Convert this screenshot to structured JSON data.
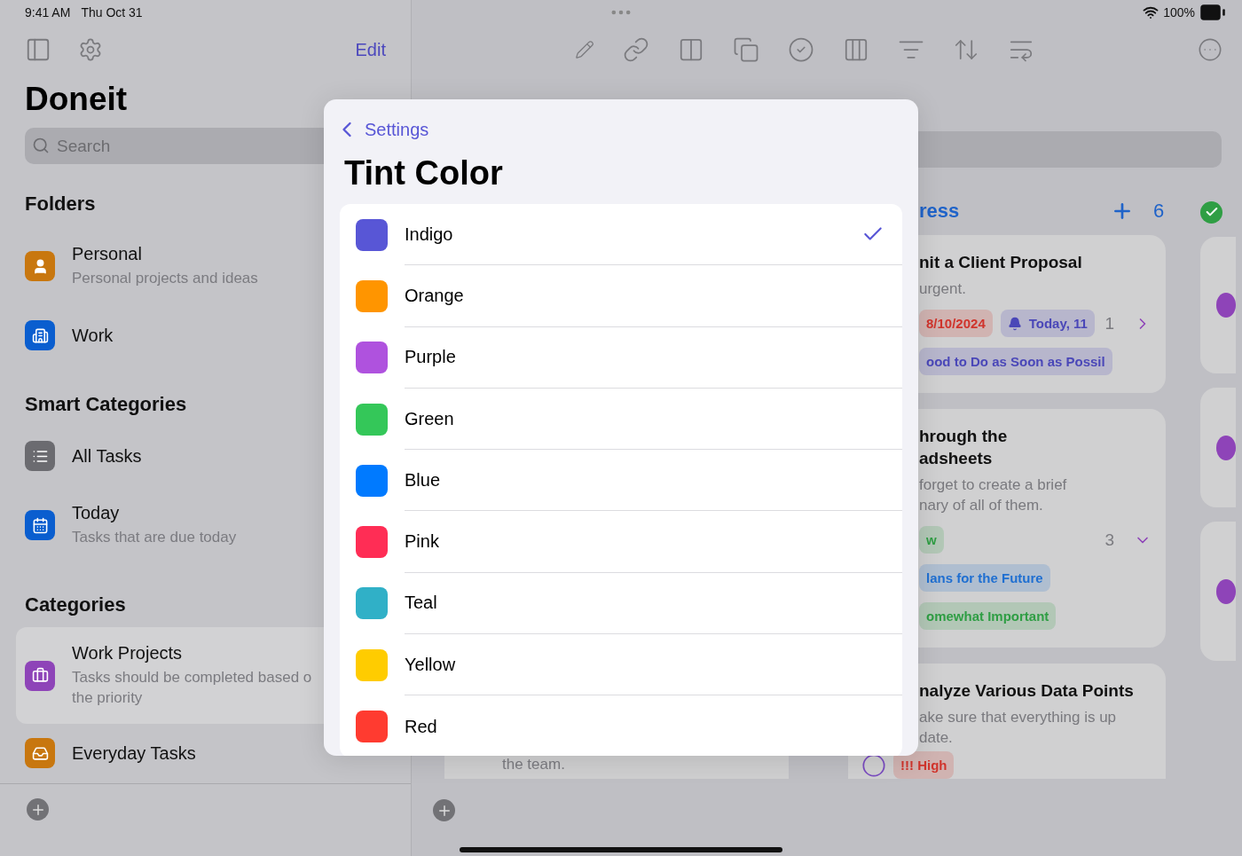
{
  "status_bar": {
    "time": "9:41 AM",
    "date": "Thu Oct 31",
    "battery": "100%"
  },
  "sidebar": {
    "edit": "Edit",
    "title": "Doneit",
    "search": {
      "placeholder": "Search"
    },
    "sections": [
      {
        "title": "Folders",
        "items": [
          {
            "title": "Personal",
            "subtitle": "Personal projects and ideas",
            "color": "#c8770f",
            "selected": false
          },
          {
            "title": "Work",
            "color": "#0a5ecf",
            "selected": false
          }
        ]
      },
      {
        "title": "Smart Categories",
        "items": [
          {
            "title": "All Tasks",
            "color": "#6b6b70",
            "selected": false
          },
          {
            "title": "Today",
            "subtitle": "Tasks that are due today",
            "color": "#0a5ecf",
            "selected": false
          }
        ]
      },
      {
        "title": "Categories",
        "items": [
          {
            "title": "Work Projects",
            "subtitle": "Tasks should be completed based o the priority",
            "color": "#8e44b8",
            "selected": true
          },
          {
            "title": "Everyday Tasks",
            "color": "#c8770f",
            "selected": false
          }
        ]
      }
    ]
  },
  "main": {
    "middle_card": {
      "text": "the team."
    },
    "column": {
      "title": "ress",
      "count": "6",
      "cards": [
        {
          "title_lines": [
            "nit a Client Proposal"
          ],
          "description_lines": [
            "urgent."
          ],
          "subtask_count": "1",
          "expanded": false,
          "tag_rows": [
            [
              {
                "kind": "date",
                "text": "8/10/2024",
                "color": "#d0342c"
              },
              {
                "kind": "reminder",
                "text": "Today, 11",
                "color": "#4a47b8"
              }
            ],
            [
              {
                "kind": "label",
                "text": "ood to Do as Soon as Possil",
                "color": "#4a47b8"
              }
            ]
          ]
        },
        {
          "title_lines": [
            "hrough the",
            "adsheets"
          ],
          "description_lines": [
            "forget to create a brief",
            "nary of all of them."
          ],
          "subtask_count": "3",
          "expanded": true,
          "tag_rows": [
            [
              {
                "kind": "label",
                "text": "w",
                "color": "#2f9e44"
              }
            ],
            [
              {
                "kind": "label",
                "text": "lans for the Future",
                "color": "#1f6fd1"
              }
            ],
            [
              {
                "kind": "label",
                "text": "omewhat Important",
                "color": "#2f9e44"
              }
            ]
          ]
        },
        {
          "title_lines": [
            "nalyze Various Data Points"
          ],
          "description_lines": [
            "ake sure that everything is up",
            "date."
          ],
          "completed": false,
          "tag_rows": [
            [
              {
                "kind": "priority",
                "text": "!!! High",
                "color": "#d0342c"
              }
            ]
          ]
        }
      ]
    }
  },
  "modal": {
    "back": "Settings",
    "title": "Tint Color",
    "options": [
      {
        "name": "Indigo",
        "color": "#5856d6",
        "selected": true
      },
      {
        "name": "Orange",
        "color": "#ff9500",
        "selected": false
      },
      {
        "name": "Purple",
        "color": "#af52de",
        "selected": false
      },
      {
        "name": "Green",
        "color": "#34c759",
        "selected": false
      },
      {
        "name": "Blue",
        "color": "#007aff",
        "selected": false
      },
      {
        "name": "Pink",
        "color": "#ff2d55",
        "selected": false
      },
      {
        "name": "Teal",
        "color": "#30b0c7",
        "selected": false
      },
      {
        "name": "Yellow",
        "color": "#ffcc00",
        "selected": false
      },
      {
        "name": "Red",
        "color": "#ff3b30",
        "selected": false
      }
    ]
  }
}
